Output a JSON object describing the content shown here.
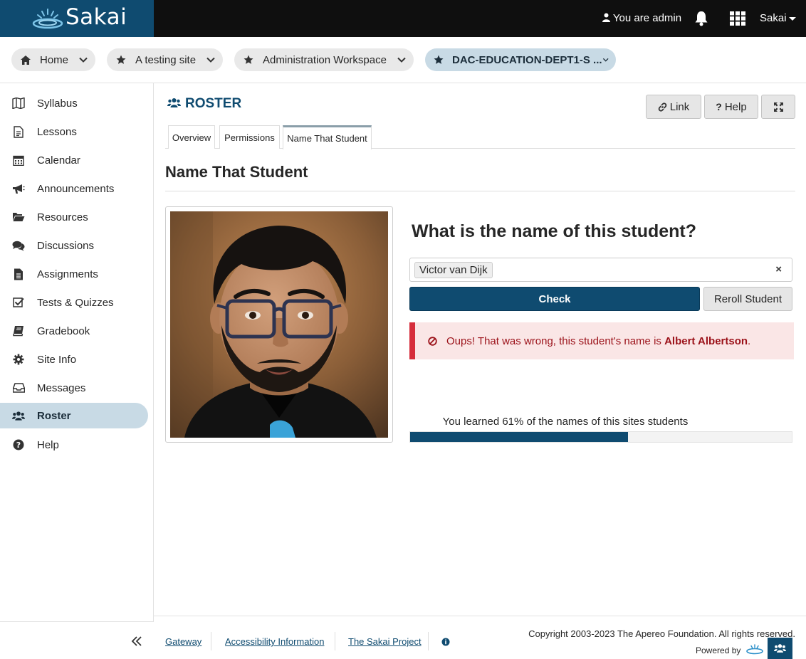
{
  "header": {
    "logo_text": "Sakai",
    "user_label": "You are admin",
    "site_menu_label": "Sakai"
  },
  "site_tabs": [
    {
      "label": "Home",
      "icon": "home-icon"
    },
    {
      "label": "A testing site",
      "icon": "star-icon"
    },
    {
      "label": "Administration Workspace",
      "icon": "star-icon"
    },
    {
      "label": "DAC-EDUCATION-DEPT1-S ...",
      "icon": "star-icon",
      "active": true
    }
  ],
  "sidebar": {
    "items": [
      {
        "label": "Syllabus",
        "icon": "map-icon"
      },
      {
        "label": "Lessons",
        "icon": "document-icon"
      },
      {
        "label": "Calendar",
        "icon": "calendar-icon"
      },
      {
        "label": "Announcements",
        "icon": "bullhorn-icon"
      },
      {
        "label": "Resources",
        "icon": "folder-icon"
      },
      {
        "label": "Discussions",
        "icon": "comments-icon"
      },
      {
        "label": "Assignments",
        "icon": "file-icon"
      },
      {
        "label": "Tests & Quizzes",
        "icon": "checkbox-icon"
      },
      {
        "label": "Gradebook",
        "icon": "book-icon"
      },
      {
        "label": "Site Info",
        "icon": "gear-icon"
      },
      {
        "label": "Messages",
        "icon": "inbox-icon"
      },
      {
        "label": "Roster",
        "icon": "users-icon",
        "active": true
      },
      {
        "label": "Help",
        "icon": "question-icon"
      }
    ]
  },
  "tool": {
    "title": "ROSTER",
    "buttons": {
      "link": "Link",
      "help": "Help"
    },
    "tabs": [
      {
        "label": "Overview"
      },
      {
        "label": "Permissions"
      },
      {
        "label": "Name That Student",
        "active": true
      }
    ]
  },
  "page": {
    "heading": "Name That Student",
    "question": "What is the name of this student?",
    "selected_name": "Victor van Dijk",
    "clear_symbol": "×",
    "check_label": "Check",
    "reroll_label": "Reroll Student",
    "alert_text": "Oups! That was wrong, this student's name is ",
    "alert_name": "Albert Albertson",
    "alert_end": ".",
    "progress_label": "You learned 61% of the names of this sites students",
    "progress_percent": 57
  },
  "footer": {
    "links": [
      "Gateway",
      "Accessibility Information",
      "The Sakai Project"
    ],
    "copyright": "Copyright 2003-2023 The Apereo Foundation. All rights reserved.",
    "powered_by": "Powered by"
  },
  "colors": {
    "brand": "#0f4b70",
    "active_nav": "#c8dae5",
    "alert_bg": "#fae6e6",
    "alert_border": "#d62d3b"
  }
}
